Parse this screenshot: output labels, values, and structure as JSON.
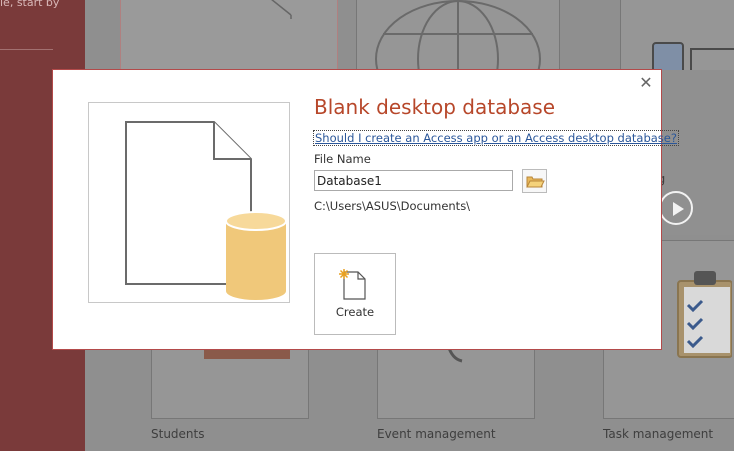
{
  "background": {
    "left_panel_partial_text": "le, start by",
    "templates": [
      {
        "label": "Students"
      },
      {
        "label": "Event management"
      },
      {
        "label": "Task management"
      }
    ],
    "partial_label": "ng"
  },
  "dialog": {
    "title": "Blank desktop database",
    "help_link": "Should I create an Access app or an Access desktop database?",
    "file_name_label": "File Name",
    "file_name_value": "Database1",
    "path": "C:\\Users\\ASUS\\Documents\\",
    "create_label": "Create",
    "close_symbol": "✕",
    "browse_icon": "folder-icon",
    "preview_icon": "blank-database-icon"
  },
  "colors": {
    "accent": "#b7472a",
    "link": "#2b579a",
    "dialog_border": "#b34a4a",
    "database_cylinder": "#f0c87a"
  }
}
